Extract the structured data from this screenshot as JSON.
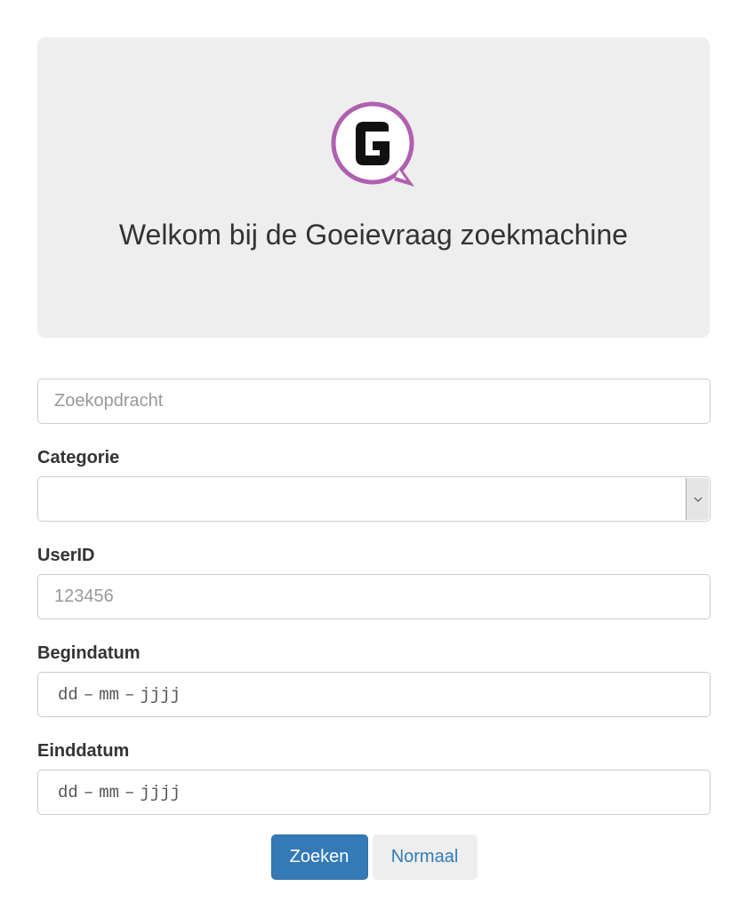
{
  "header": {
    "logo_name": "goeievraag-logo-icon",
    "welcome_text": "Welkom bij de Goeievraag zoekmachine",
    "logo_ring_color": "#b060b0"
  },
  "search": {
    "placeholder": "Zoekopdracht",
    "value": ""
  },
  "category": {
    "label": "Categorie",
    "selected": ""
  },
  "userid": {
    "label": "UserID",
    "placeholder": "123456",
    "value": ""
  },
  "begindatum": {
    "label": "Begindatum",
    "dd": "dd",
    "mm": "mm",
    "yyyy": "jjjj",
    "sep": "–"
  },
  "einddatum": {
    "label": "Einddatum",
    "dd": "dd",
    "mm": "mm",
    "yyyy": "jjjj",
    "sep": "–"
  },
  "buttons": {
    "search_label": "Zoeken",
    "normal_label": "Normaal"
  },
  "colors": {
    "primary": "#337ab7",
    "jumbotron_bg": "#eeeeee"
  }
}
